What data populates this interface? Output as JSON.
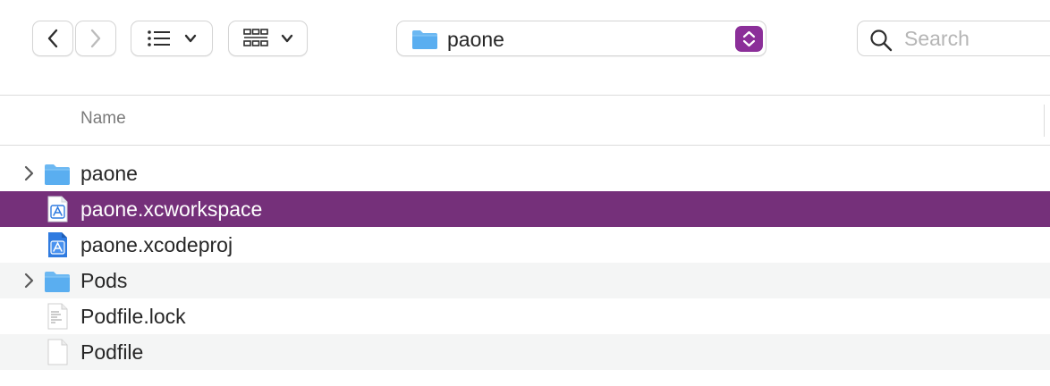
{
  "toolbar": {
    "path_label": "paone",
    "search_placeholder": "Search"
  },
  "header": {
    "name_column": "Name"
  },
  "files": [
    {
      "label": "paone",
      "kind": "folder",
      "expandable": true,
      "selected": false
    },
    {
      "label": "paone.xcworkspace",
      "kind": "xcworkspace",
      "expandable": false,
      "selected": true
    },
    {
      "label": "paone.xcodeproj",
      "kind": "xcodeproj",
      "expandable": false,
      "selected": false
    },
    {
      "label": "Pods",
      "kind": "folder",
      "expandable": true,
      "selected": false
    },
    {
      "label": "Podfile.lock",
      "kind": "text-document",
      "expandable": false,
      "selected": false
    },
    {
      "label": "Podfile",
      "kind": "blank-document",
      "expandable": false,
      "selected": false
    }
  ],
  "colors": {
    "selection": "#75307a",
    "stepper_accent": "#8b2f99",
    "folder_blue": "#5aaef0",
    "alt_row": "#f4f5f5"
  }
}
